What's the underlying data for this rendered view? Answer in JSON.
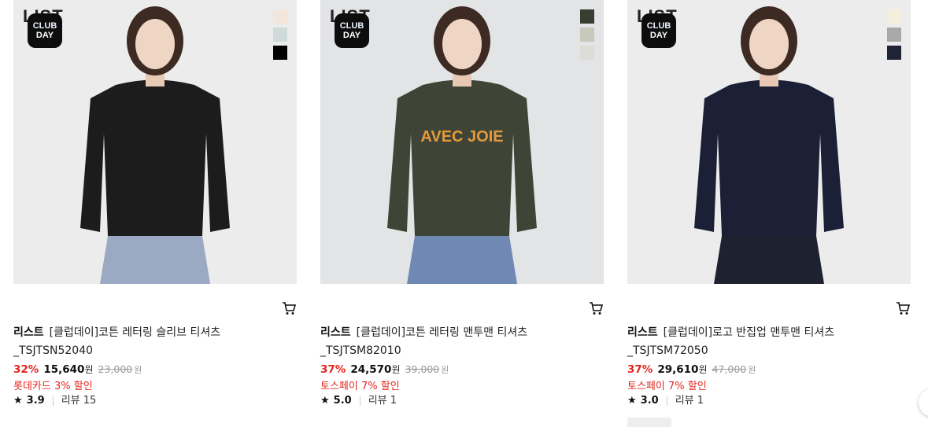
{
  "products": [
    {
      "watermark": "LIST",
      "badge": {
        "line1": "CLUB",
        "line2": "DAY"
      },
      "swatches": [
        "#f3e6dd",
        "#cfdad9",
        "#000000"
      ],
      "brand": "리스트",
      "name_line1": "[클럽데이]코튼 레터링 슬리브 티셔츠",
      "name_line2": "_TSJTSN52040",
      "discount": "32%",
      "sale_price": "15,640",
      "currency": "원",
      "original_price": "23,000",
      "promo": "롯데카드 3% 할인",
      "rating": "3.9",
      "reviews": "리뷰 15",
      "sweater_text": "",
      "colors": {
        "bg": "#ececec",
        "top": "#1c1c1c",
        "pants": "#9ba9c2"
      }
    },
    {
      "watermark": "LIST",
      "badge": {
        "line1": "CLUB",
        "line2": "DAY"
      },
      "swatches": [
        "#3a3d32",
        "#c7c9bb",
        "#dcdcd8"
      ],
      "brand": "리스트",
      "name_line1": "[클럽데이]코튼 레터링 맨투맨 티셔츠",
      "name_line2": "_TSJTSM82010",
      "discount": "37%",
      "sale_price": "24,570",
      "currency": "원",
      "original_price": "39,000",
      "promo": "토스페이 7% 할인",
      "rating": "5.0",
      "reviews": "리뷰 1",
      "sweater_text": "AVEC JOIE",
      "colors": {
        "bg": "#e3e4e6",
        "top": "#3e4536",
        "pants": "#6f88b4"
      }
    },
    {
      "watermark": "LIST",
      "badge": {
        "line1": "CLUB",
        "line2": "DAY"
      },
      "swatches": [
        "#f4efdc",
        "#a8a8a8",
        "#1e2336"
      ],
      "brand": "리스트",
      "name_line1": "[클럽데이]로고 반집업 맨투맨 티셔츠",
      "name_line2": "_TSJTSM72050",
      "discount": "37%",
      "sale_price": "29,610",
      "currency": "원",
      "original_price": "47,000",
      "promo": "토스페이 7% 할인",
      "rating": "3.0",
      "reviews": "리뷰 1",
      "sweater_text": "",
      "colors": {
        "bg": "#ececec",
        "top": "#1b2036",
        "pants": "#1e2130"
      }
    }
  ]
}
